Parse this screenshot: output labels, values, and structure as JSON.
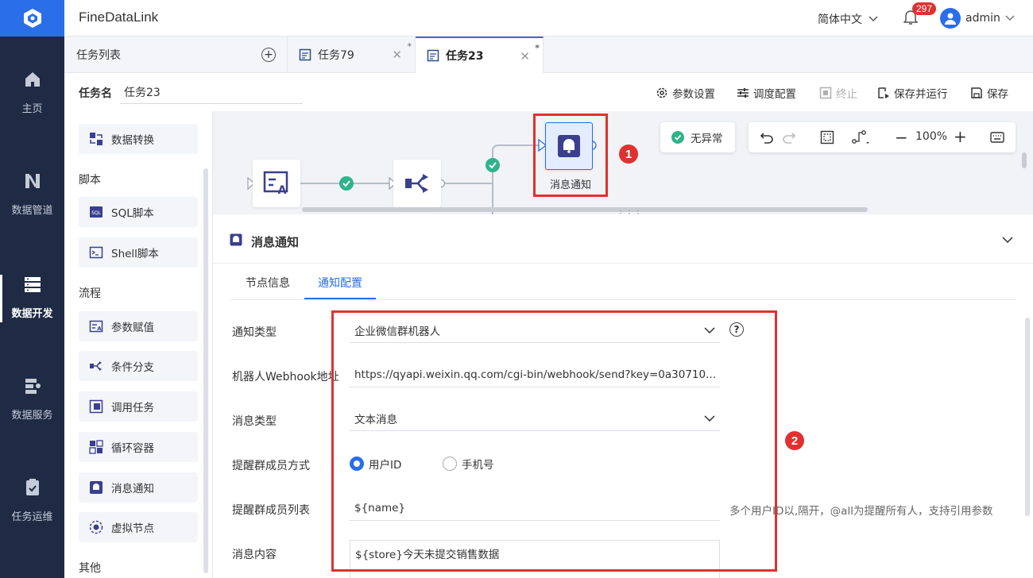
{
  "app": {
    "title": "FineDataLink"
  },
  "header": {
    "language": "简体中文",
    "notification_count": "297",
    "user": "admin"
  },
  "nav": {
    "items": [
      {
        "label": "主页",
        "icon": "home-icon"
      },
      {
        "label": "数据管道",
        "icon": "pipeline-icon"
      },
      {
        "label": "数据开发",
        "icon": "dev-icon",
        "active": true
      },
      {
        "label": "数据服务",
        "icon": "service-icon"
      },
      {
        "label": "任务运维",
        "icon": "ops-icon"
      }
    ]
  },
  "tabs": {
    "task_list": "任务列表",
    "items": [
      {
        "label": "任务79",
        "modified": "*"
      },
      {
        "label": "任务23",
        "modified": "*",
        "active": true
      }
    ]
  },
  "toolbar": {
    "task_name_label": "任务名",
    "task_name_value": "任务23",
    "buttons": [
      "参数设置",
      "调度配置",
      "终止",
      "保存并运行",
      "保存"
    ]
  },
  "palette": {
    "items_top": [
      "数据转换"
    ],
    "section_script": "脚本",
    "script_items": [
      "SQL脚本",
      "Shell脚本"
    ],
    "section_flow": "流程",
    "flow_items": [
      "参数赋值",
      "条件分支",
      "调用任务",
      "循环容器",
      "消息通知",
      "虚拟节点"
    ],
    "section_other": "其他"
  },
  "canvas": {
    "status": "无异常",
    "zoom": "100%",
    "selected_node_label": "消息通知",
    "callout_1": "1",
    "callout_2": "2"
  },
  "panel": {
    "title": "消息通知",
    "tabs": [
      "节点信息",
      "通知配置"
    ],
    "active_tab": "通知配置",
    "fields": {
      "notify_type_label": "通知类型",
      "notify_type_value": "企业微信群机器人",
      "webhook_label": "机器人Webhook地址",
      "webhook_value": "https://qyapi.weixin.qq.com/cgi-bin/webhook/send?key=0a30710...",
      "msg_type_label": "消息类型",
      "msg_type_value": "文本消息",
      "remind_mode_label": "提醒群成员方式",
      "remind_mode_options": [
        "用户ID",
        "手机号"
      ],
      "remind_mode_selected": "用户ID",
      "remind_list_label": "提醒群成员列表",
      "remind_list_value": "${name}",
      "remind_list_hint": "多个用户ID以,隔开，@all为提醒所有人，支持引用参数",
      "content_label": "消息内容",
      "content_value": "${store}今天未提交销售数据"
    }
  },
  "colors": {
    "accent": "#2a6ee8",
    "nav_bg": "#1f2a44",
    "highlight": "#e0312f",
    "success": "#2fb38a"
  }
}
